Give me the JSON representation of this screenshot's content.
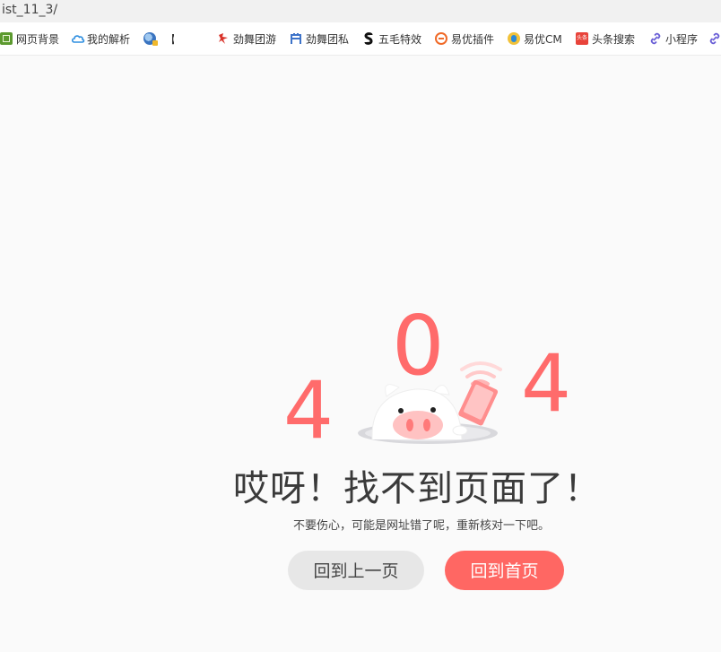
{
  "url": "ist_11_3/",
  "bookmarks": [
    {
      "label": "网页背景",
      "icon": "green-square-icon"
    },
    {
      "label": "我的解析",
      "icon": "cloud-icon"
    },
    {
      "label": "【",
      "icon": "globe-icon"
    },
    {
      "label": "劲舞团游",
      "icon": "red-leaf-icon"
    },
    {
      "label": "劲舞团私",
      "icon": "blue-a-icon"
    },
    {
      "label": "五毛特效",
      "icon": "black-s-icon"
    },
    {
      "label": "易优插件",
      "icon": "e-icon"
    },
    {
      "label": "易优CM",
      "icon": "yellow-face-icon"
    },
    {
      "label": "头条搜索",
      "icon": "toutiao-icon"
    },
    {
      "label": "小程序",
      "icon": "link-icon"
    }
  ],
  "error": {
    "digit1": "4",
    "digit2": "0",
    "digit3": "4",
    "title": "哎呀！找不到页面了！",
    "subtitle": "不要伤心，可能是网址错了呢，重新核对一下吧。"
  },
  "buttons": {
    "back": "回到上一页",
    "home": "回到首页"
  },
  "colors": {
    "accent": "#ff6763",
    "digits": "#ff6b6b",
    "back_button": "#e7e7e7",
    "background": "#fafafa"
  }
}
